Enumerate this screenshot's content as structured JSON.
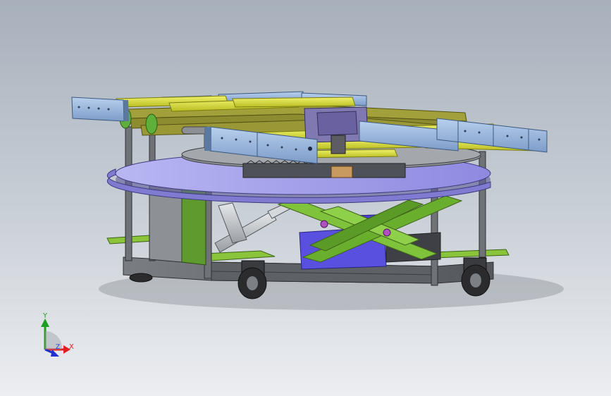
{
  "viewport": {
    "background_top": "#a7b0bb",
    "background_bottom": "#eceef1"
  },
  "model": {
    "colors": {
      "frame": "#6b6e73",
      "frame_dark": "#3e4044",
      "conveyor_rail": "#8fb0d8",
      "roller_yellow": "#d8dc3a",
      "belt": "#a2a03a",
      "turntable": "#a7a4ec",
      "turntable_dark": "#7f7bd0",
      "scissor_arm": "#7fc23c",
      "scissor_arm_dark": "#4f8a22",
      "cylinder": "#c9ccd0",
      "motor": "#5a50e0",
      "base_plate": "#8ac43a",
      "wheel": "#2b2b2e",
      "gear": "#555a60",
      "pivot": "#b050c0"
    }
  },
  "triad": {
    "labels": {
      "x": "X",
      "y": "Y",
      "z": "Z"
    },
    "colors": {
      "x": "#e02020",
      "y": "#20a020",
      "z": "#2030d0"
    },
    "icons": [
      "x-axis-arrow-icon",
      "y-axis-arrow-icon",
      "z-axis-arrow-icon"
    ]
  }
}
